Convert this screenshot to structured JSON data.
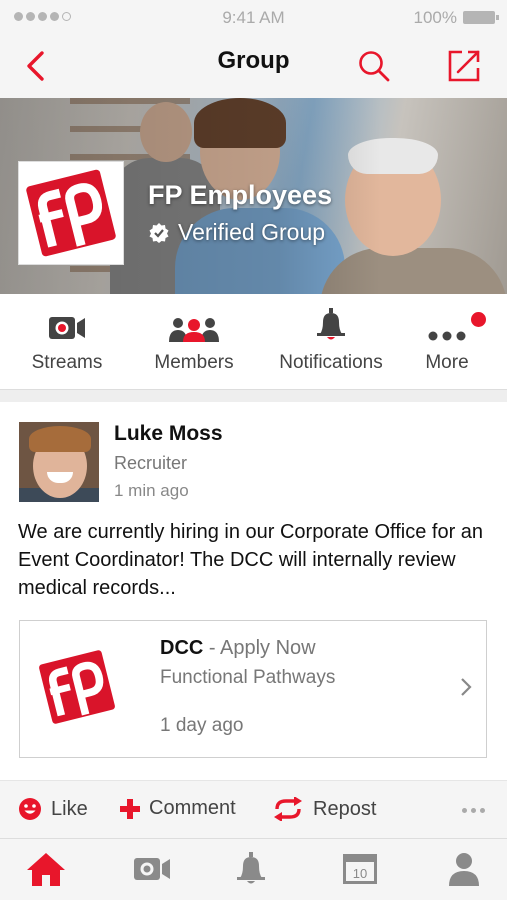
{
  "status_bar": {
    "time": "9:41 AM",
    "battery": "100%"
  },
  "navbar": {
    "title": "Group"
  },
  "group": {
    "name": "FP Employees",
    "verified_label": "Verified Group"
  },
  "tabs": [
    {
      "label": "Streams",
      "icon": "video-camera-icon"
    },
    {
      "label": "Members",
      "icon": "members-icon"
    },
    {
      "label": "Notifications",
      "icon": "bell-icon"
    },
    {
      "label": "More",
      "icon": "more-dots-icon"
    }
  ],
  "post": {
    "author": "Luke Moss",
    "role": "Recruiter",
    "time": "1 min ago",
    "text": "We are currently hiring in our Corporate Office for an Event Coordinator! The DCC will internally review medical records...",
    "attachment": {
      "title": "DCC",
      "separator": " - ",
      "action": "Apply Now",
      "company": "Functional Pathways",
      "time": "1 day ago"
    }
  },
  "actions": {
    "like": "Like",
    "comment": "Comment",
    "repost": "Repost"
  },
  "tabbar": {
    "calendar_day": "10"
  },
  "colors": {
    "accent": "#e8162b",
    "bar": "#f5f5f5",
    "icon_gray": "#8a8a8a"
  }
}
